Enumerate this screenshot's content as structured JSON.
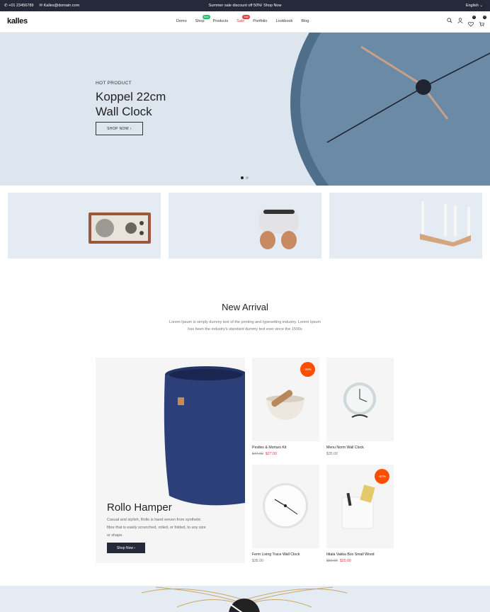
{
  "topbar": {
    "phone": "+01 23456789",
    "email": "Kalles@domain.com",
    "promo": "Summer sale discount off 50%! Shop Now",
    "language": "English"
  },
  "nav": {
    "logo": "kalles",
    "menu": [
      {
        "label": "Demo"
      },
      {
        "label": "Shop",
        "badge": "New",
        "badge_color": "#1fbf6b"
      },
      {
        "label": "Products"
      },
      {
        "label": "Sale",
        "badge": "Sale",
        "badge_color": "#e53b3b"
      },
      {
        "label": "Portfolio"
      },
      {
        "label": "Lookbook"
      },
      {
        "label": "Blog"
      }
    ],
    "wishlist_count": "0",
    "cart_count": "0"
  },
  "hero": {
    "pretitle": "HOT PRODUCT",
    "title_line1": "Koppel 22cm",
    "title_line2": "Wall Clock",
    "button": "SHOP NOW"
  },
  "new_arrival": {
    "title": "New Arrival",
    "subtitle_line1": "Lorem Ipsum is simply dummy text of the printing and typesetting industry. Lorem Ipsum",
    "subtitle_line2": "has been the industry's standard dummy text ever since the 1500s"
  },
  "featured": {
    "title": "Rollo Hamper",
    "description": "Casual and stylish, Rollo is hand woven from synthetic fibre that is easily scrunched, rolled, or folded, to any size or shape.",
    "button": "Shop Now"
  },
  "products": [
    {
      "name": "Pestles & Mortars Kit",
      "old_price": "$47.00",
      "price": "$27.00",
      "discount": "-26%"
    },
    {
      "name": "Menu Norm Wall Clock",
      "old_price": "",
      "price": "$35.00",
      "discount": ""
    },
    {
      "name": "Ferm Living Trace Wall Clock",
      "old_price": "",
      "price": "$35.00",
      "discount": ""
    },
    {
      "name": "Iittala Vakka Box Small Wood",
      "old_price": "$59.00",
      "price": "$20.00",
      "discount": "-52%"
    }
  ],
  "colors": {
    "topbar_bg": "#252a3a",
    "accent_sale": "#e53b3b",
    "discount_badge": "#ff4e00",
    "hero_bg": "#dde5ee"
  }
}
